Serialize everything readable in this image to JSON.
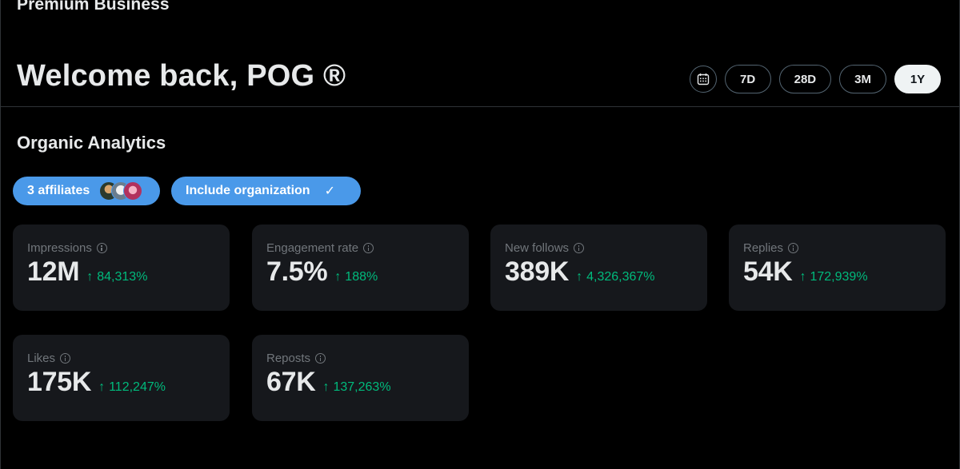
{
  "header": {
    "top_title": "Premium Business",
    "welcome": "Welcome back, POG ®"
  },
  "range": {
    "calendar_icon": "calendar-icon",
    "buttons": [
      "7D",
      "28D",
      "3M",
      "1Y"
    ],
    "active": "1Y"
  },
  "section": {
    "title": "Organic Analytics"
  },
  "chips": {
    "affiliates_label": "3 affiliates",
    "affiliate_avatars": 3,
    "org_label": "Include organization",
    "org_check": "✓"
  },
  "metrics": [
    {
      "label": "Impressions",
      "value": "12M",
      "arrow": "↑",
      "change": "84,313%"
    },
    {
      "label": "Engagement rate",
      "value": "7.5%",
      "arrow": "↑",
      "change": "188%"
    },
    {
      "label": "New follows",
      "value": "389K",
      "arrow": "↑",
      "change": "4,326,367%"
    },
    {
      "label": "Replies",
      "value": "54K",
      "arrow": "↑",
      "change": "172,939%"
    },
    {
      "label": "Likes",
      "value": "175K",
      "arrow": "↑",
      "change": "112,247%"
    },
    {
      "label": "Reposts",
      "value": "67K",
      "arrow": "↑",
      "change": "137,263%"
    }
  ],
  "colors": {
    "background": "#000000",
    "card": "#16181c",
    "accent": "#4a99e9",
    "positive": "#00ba7c",
    "muted": "#71767b"
  }
}
